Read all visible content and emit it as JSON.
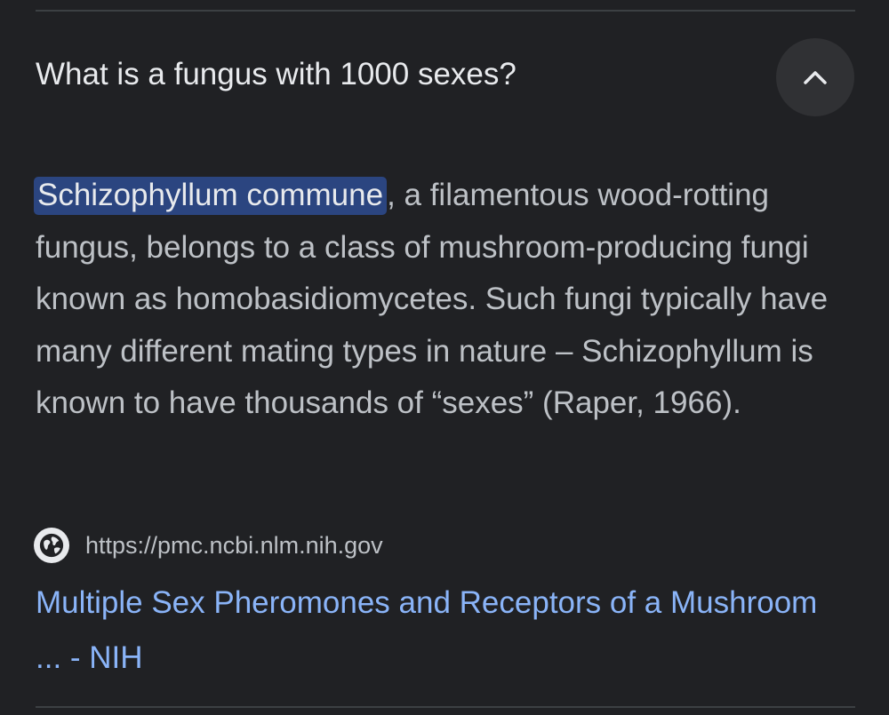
{
  "question": {
    "text": "What is a fungus with 1000 sexes?",
    "collapse_icon": "chevron-up-icon"
  },
  "answer": {
    "highlight": "Schizophyllum commune",
    "text": ", a filamentous wood-rotting fungus, belongs to a class of mushroom-producing fungi known as homobasidiomycetes. Such fungi typically have many different mating types in nature – Schizophyllum is known to have thousands of “sexes” (Raper, 1966)."
  },
  "source": {
    "icon": "globe-icon",
    "url": "https://pmc.ncbi.nlm.nih.gov",
    "title": "Multiple Sex Pheromones and Receptors of a Mushroom ... - NIH"
  },
  "colors": {
    "background": "#202124",
    "highlight": "#2b4580",
    "link": "#8ab4f8"
  }
}
